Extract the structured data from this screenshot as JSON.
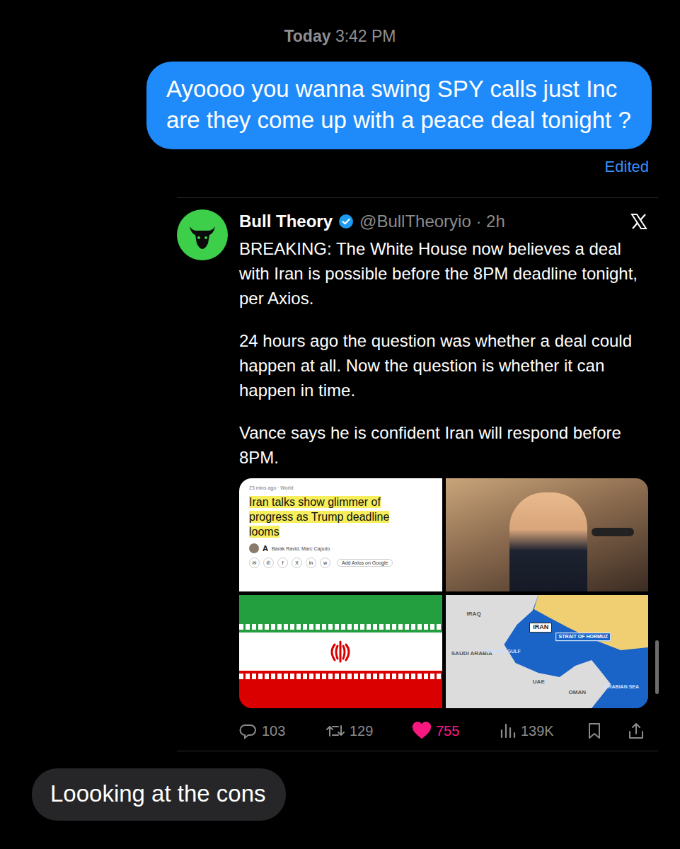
{
  "timestamp": {
    "day": "Today",
    "time": "3:42 PM"
  },
  "sent_message": {
    "text": "Ayoooo you wanna swing SPY calls just Inc are they come up with a peace deal tonight ?",
    "status": "Edited"
  },
  "tweet": {
    "name": "Bull Theory",
    "verified": true,
    "meta": "@BullTheoryio · 2h",
    "paragraphs": [
      "BREAKING: The White House now believes a deal with Iran is possible before the 8PM deadline tonight, per Axios.",
      "24 hours ago the question was whether a deal could happen at all. Now the question is whether it can happen in time.",
      "Vance says he is confident Iran will respond before 8PM."
    ],
    "article": {
      "time": "23 mins ago · World",
      "headline": "Iran talks show glimmer of progress as Trump deadline looms",
      "logo": "A",
      "authors": "Barak Ravid, Marc Caputo",
      "share_icons": [
        "✉",
        "✆",
        "f",
        "X",
        "in",
        "w"
      ],
      "action": "Add Axios on Google"
    },
    "map_labels": [
      {
        "text": "IRAQ",
        "kind": "land"
      },
      {
        "text": "IRAN",
        "kind": "boxed"
      },
      {
        "text": "SAUDI ARABIA",
        "kind": "land"
      },
      {
        "text": "PERSIAN GULF",
        "kind": "sea"
      },
      {
        "text": "STRAIT OF HORMUZ",
        "kind": "strait"
      },
      {
        "text": "UAE",
        "kind": "land"
      },
      {
        "text": "OMAN",
        "kind": "land"
      },
      {
        "text": "ARABIAN SEA",
        "kind": "sea"
      }
    ],
    "stats": {
      "replies": "103",
      "reposts": "129",
      "likes": "755",
      "liked": true,
      "views": "139K"
    }
  },
  "received_message": {
    "text": "Loooking at the cons"
  }
}
